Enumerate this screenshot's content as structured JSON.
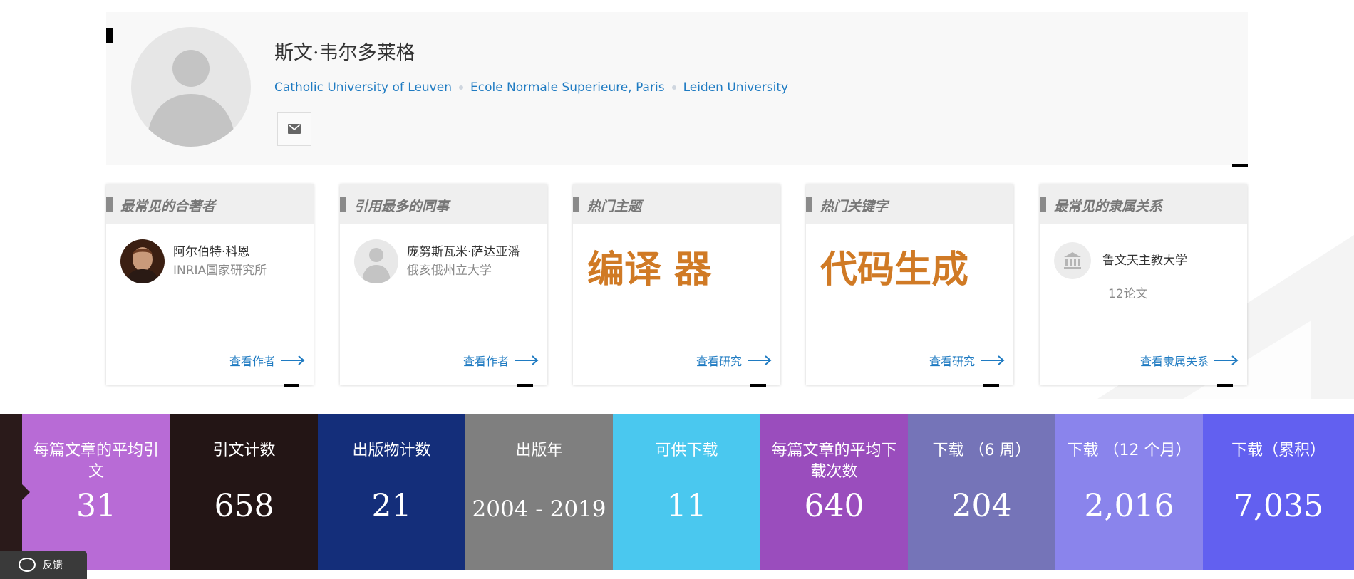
{
  "profile": {
    "name": "斯文·韦尔多莱格",
    "affiliations": [
      "Catholic University of Leuven",
      "Ecole Normale Superieure, Paris",
      "Leiden University"
    ],
    "avatar_icon": "user-placeholder-icon",
    "mail_icon": "mail-icon"
  },
  "cards": [
    {
      "title": "最常见的合著者",
      "type": "person",
      "person_name": "阿尔伯特·科恩",
      "person_org": "INRIA国家研究所",
      "link": "查看作者"
    },
    {
      "title": "引用最多的同事",
      "type": "person",
      "person_name": "庞努斯瓦米·萨达亚潘",
      "person_org": "俄亥俄州立大学",
      "link": "查看作者"
    },
    {
      "title": "热门主题",
      "type": "topic",
      "topic": "编译 器",
      "link": "查看研究"
    },
    {
      "title": "热门关键字",
      "type": "topic",
      "topic": "代码生成",
      "link": "查看研究"
    },
    {
      "title": "最常见的隶属关系",
      "type": "institution",
      "inst_name": "鲁文天主教大学",
      "inst_count": "12论文",
      "link": "查看隶属关系"
    }
  ],
  "stats": [
    {
      "label": "每篇文章的平均引文",
      "value": "31",
      "color": "#b86bd6"
    },
    {
      "label": "引文计数",
      "value": "658",
      "color": "#231515"
    },
    {
      "label": "出版物计数",
      "value": "21",
      "color": "#142e7a"
    },
    {
      "label": "出版年",
      "value": "2004 - 2019",
      "color": "#7f7f7f"
    },
    {
      "label": "可供下载",
      "value": "11",
      "color": "#4ac8ef"
    },
    {
      "label": "每篇文章的平均下载次数",
      "value": "640",
      "color": "#9a4dbd"
    },
    {
      "label": "下载 （6 周）",
      "value": "204",
      "color": "#7574b8"
    },
    {
      "label": "下载 （12 个月）",
      "value": "2,016",
      "color": "#8a84ec"
    },
    {
      "label": "下载（累积）",
      "value": "7,035",
      "color": "#6260f0"
    }
  ],
  "feedback": {
    "label": "反馈"
  }
}
